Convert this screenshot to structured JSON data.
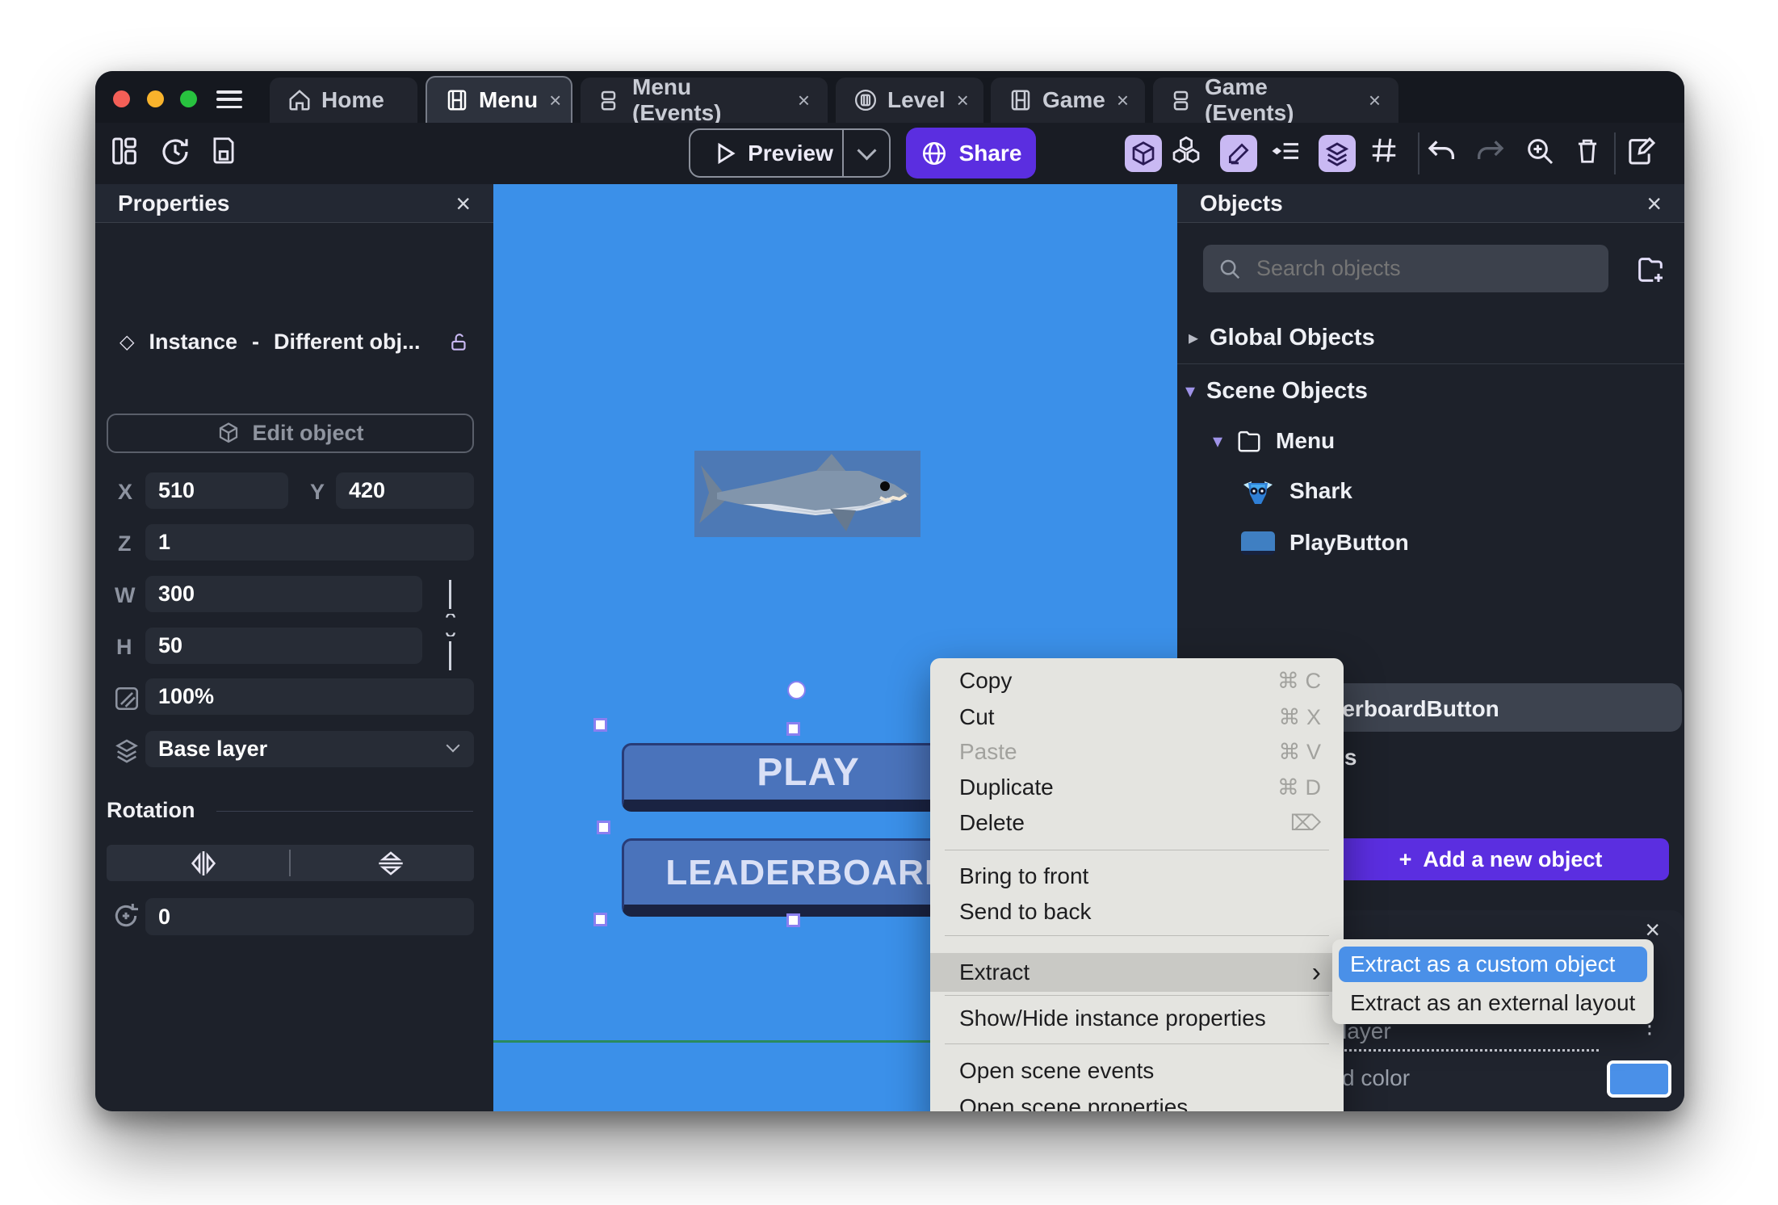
{
  "titlebar": {
    "tabs": [
      {
        "label": "Home"
      },
      {
        "label": "Menu",
        "close": "×"
      },
      {
        "label": "Menu (Events)",
        "close": "×"
      },
      {
        "label": "Level",
        "close": "×"
      },
      {
        "label": "Game",
        "close": "×"
      },
      {
        "label": "Game (Events)",
        "close": "×"
      }
    ]
  },
  "toolbar": {
    "preview_label": "Preview",
    "share_label": "Share"
  },
  "properties": {
    "title": "Properties",
    "close": "×",
    "instance_type": "Instance",
    "separator": "-",
    "instance_name": "Different obj...",
    "edit_object_label": "Edit object",
    "x_label": "X",
    "x_value": "510",
    "y_label": "Y",
    "y_value": "420",
    "z_label": "Z",
    "z_value": "1",
    "w_label": "W",
    "w_value": "300",
    "h_label": "H",
    "h_value": "50",
    "opacity_value": "100%",
    "layer_value": "Base layer",
    "rotation_title": "Rotation",
    "rotation_value": "0"
  },
  "canvas": {
    "play_label": "PLAY",
    "leaderboard_label": "LEADERBOARD"
  },
  "objects": {
    "title": "Objects",
    "close": "×",
    "search_placeholder": "Search objects",
    "global_label": "Global Objects",
    "scene_label": "Scene Objects",
    "menu_folder": "Menu",
    "settings_folder": "Settings",
    "shark": "Shark",
    "play_button": "PlayButton",
    "leaderboard_button": "LeaderboardButton",
    "add_button_label": "Add a new object",
    "add_plus": "+"
  },
  "context_menu": {
    "copy": "Copy",
    "copy_sc": "⌘ C",
    "cut": "Cut",
    "cut_sc": "⌘ X",
    "paste": "Paste",
    "paste_sc": "⌘ V",
    "duplicate": "Duplicate",
    "duplicate_sc": "⌘ D",
    "delete": "Delete",
    "delete_sc": "⌦",
    "bring_to_front": "Bring to front",
    "send_to_back": "Send to back",
    "extract": "Extract",
    "extract_arrow": "›",
    "show_hide": "Show/Hide instance properties",
    "open_scene_events": "Open scene events",
    "open_scene_properties": "Open scene properties"
  },
  "submenu": {
    "custom_object": "Extract as a custom object",
    "external_layout": "Extract as an external layout"
  },
  "bottom_panel": {
    "close": "×",
    "layer_text": "layer",
    "color_text": "d color",
    "kebab": "⋮",
    "swatch_color": "#4a90e8"
  },
  "glyphs": {
    "kebab": "⋮",
    "caret_right": "▸",
    "caret_down": "▾",
    "hash": "#",
    "undo": "↶",
    "redo": "↷"
  },
  "colors": {
    "accent_purple": "#5b2ee0",
    "canvas_blue": "#3b90e9",
    "selection_blue": "#4a90e8"
  }
}
